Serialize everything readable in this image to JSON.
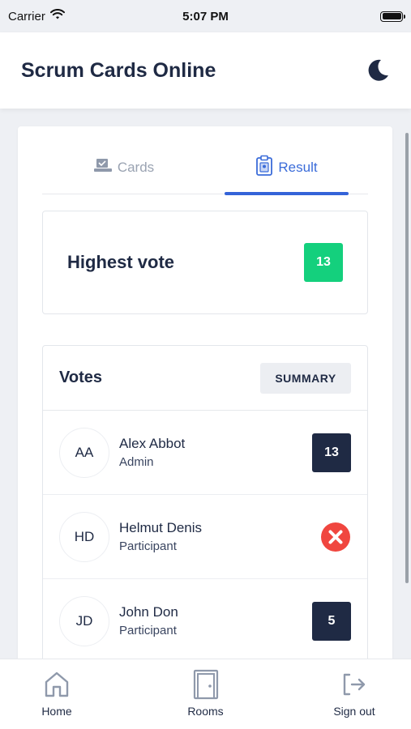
{
  "status_bar": {
    "carrier": "Carrier",
    "time": "5:07 PM"
  },
  "header": {
    "title": "Scrum Cards Online",
    "theme_icon": "moon-icon"
  },
  "tabs": [
    {
      "label": "Cards",
      "icon": "cards-icon",
      "active": false
    },
    {
      "label": "Result",
      "icon": "clipboard-icon",
      "active": true
    }
  ],
  "highest_vote": {
    "label": "Highest vote",
    "value": "13",
    "color": "#14d07d"
  },
  "votes": {
    "title": "Votes",
    "summary_label": "SUMMARY",
    "rows": [
      {
        "initials": "AA",
        "name": "Alex Abbot",
        "role": "Admin",
        "vote": "13"
      },
      {
        "initials": "HD",
        "name": "Helmut Denis",
        "role": "Participant",
        "vote": null,
        "no_vote_icon": "close-circle-icon"
      },
      {
        "initials": "JD",
        "name": "John Don",
        "role": "Participant",
        "vote": "5"
      }
    ]
  },
  "bottom_nav": {
    "home": "Home",
    "rooms": "Rooms",
    "signout": "Sign out"
  },
  "colors": {
    "accent": "#3463d8",
    "dark_badge": "#1f2a44",
    "danger": "#f0463f"
  }
}
